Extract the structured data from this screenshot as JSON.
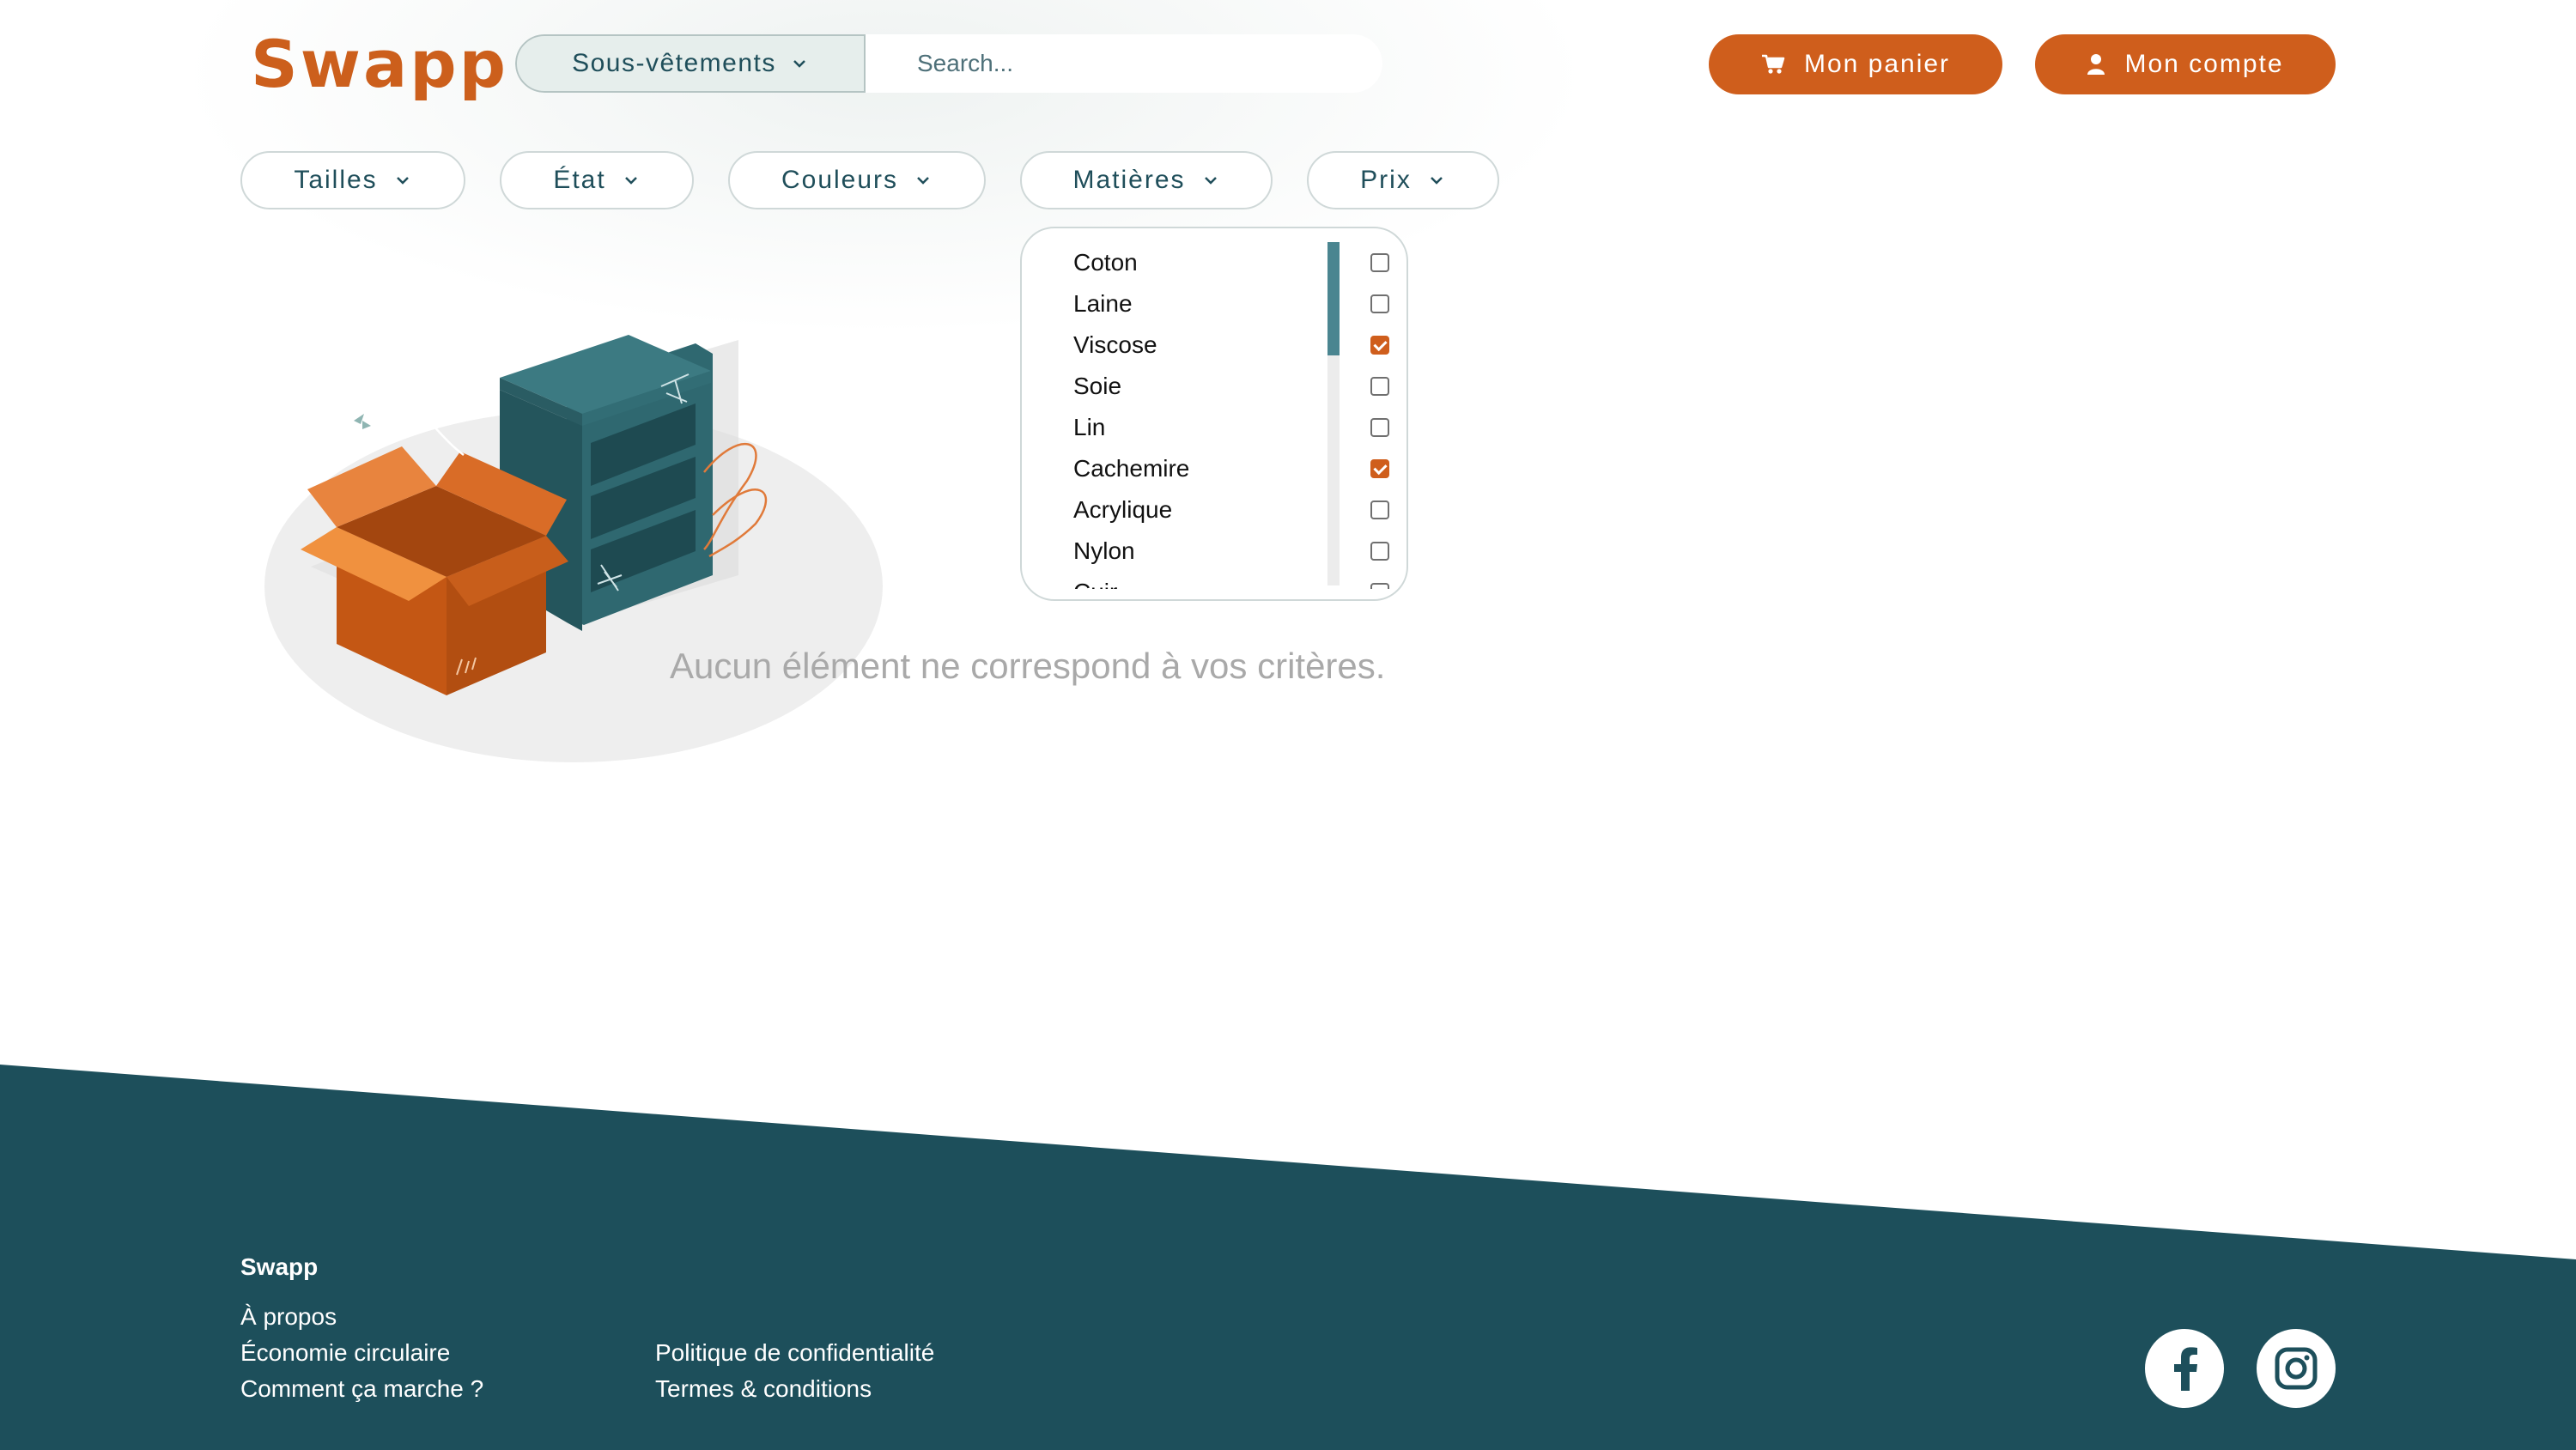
{
  "header": {
    "logo": "Swapp",
    "category": "Sous-vêtements",
    "search_placeholder": "Search...",
    "cart_label": "Mon panier",
    "account_label": "Mon compte"
  },
  "filters": [
    {
      "label": "Tailles"
    },
    {
      "label": "État"
    },
    {
      "label": "Couleurs"
    },
    {
      "label": "Matières"
    },
    {
      "label": "Prix"
    }
  ],
  "materials_dropdown": {
    "options": [
      {
        "label": "Coton",
        "checked": false
      },
      {
        "label": "Laine",
        "checked": false
      },
      {
        "label": "Viscose",
        "checked": true
      },
      {
        "label": "Soie",
        "checked": false
      },
      {
        "label": "Lin",
        "checked": false
      },
      {
        "label": "Cachemire",
        "checked": true
      },
      {
        "label": "Acrylique",
        "checked": false
      },
      {
        "label": "Nylon",
        "checked": false
      },
      {
        "label": "Cuir",
        "checked": false
      }
    ]
  },
  "main": {
    "empty_message": "Aucun élément ne correspond à vos critères."
  },
  "footer": {
    "title": "Swapp",
    "links_col1": [
      "À propos",
      "Économie circulaire",
      "Comment ça marche ?"
    ],
    "links_col2": [
      "Politique de confidentialité",
      "Termes & conditions"
    ],
    "social": [
      "facebook-icon",
      "instagram-icon"
    ]
  },
  "colors": {
    "accent": "#cf5e1c",
    "dark_teal": "#1d4f5b",
    "scroll_thumb": "#4a8590"
  }
}
